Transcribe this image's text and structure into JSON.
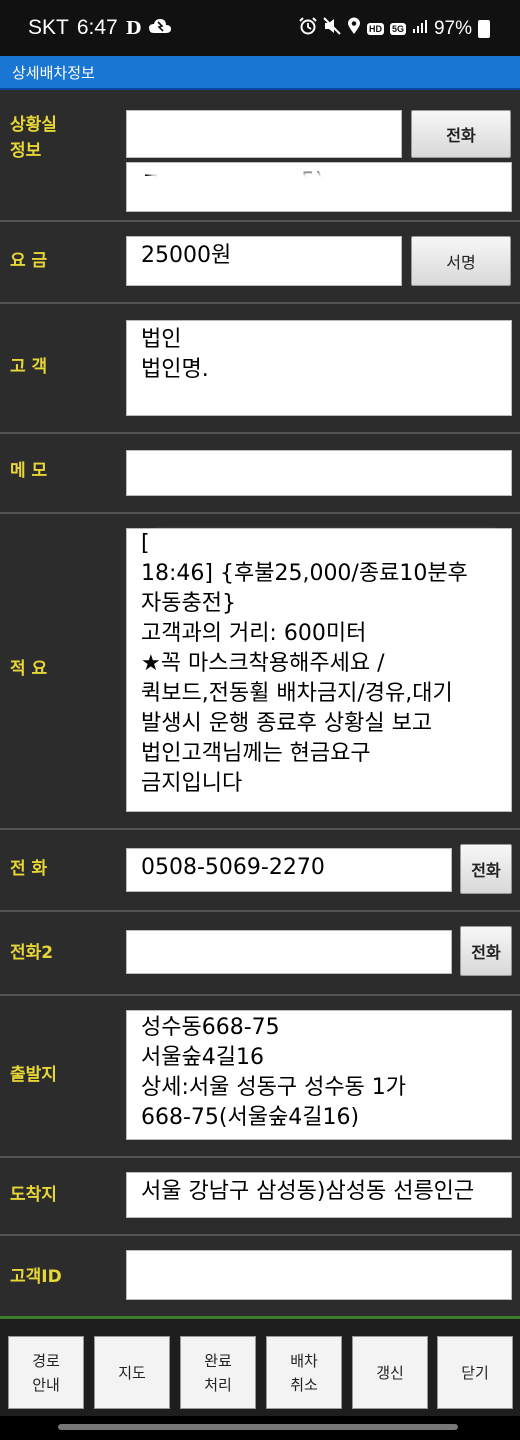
{
  "status_bar": {
    "carrier": "SKT",
    "time": "6:47",
    "extra": "D",
    "battery": "97%",
    "hd_badge": "HD",
    "fiveg_badge": "5G"
  },
  "title": "상세배차정보",
  "situation": {
    "label": "상황실\n정보",
    "value_top": "",
    "value_bottom": "ㄱ                    5)",
    "call_button": "전화"
  },
  "fare": {
    "label": "요 금",
    "value": "25000원",
    "sign_button": "서명"
  },
  "customer": {
    "label": "고 객",
    "value": "법인\n법인명."
  },
  "memo": {
    "label": "메 모",
    "value": ""
  },
  "summary": {
    "label": "적 요",
    "value": "[             \n18:46] {후불25,000/종료10분후\n자동충전}\n고객과의 거리: 600미터\n★꼭 마스크착용해주세요 /\n퀵보드,전동휠 배차금지/경유,대기\n발생시 운행 종료후 상황실 보고\n법인고객님께는 현금요구\n금지입니다"
  },
  "phone": {
    "label": "전 화",
    "value": "0508-5069-2270",
    "call_button": "전화"
  },
  "phone2": {
    "label": "전화2",
    "value": "",
    "call_button": "전화"
  },
  "departure": {
    "label": "출발지",
    "value": "성수동668-75\n서울숲4길16\n상세:서울 성동구 성수동 1가\n668-75(서울숲4길16)"
  },
  "destination": {
    "label": "도착지",
    "value": "서울 강남구 삼성동)삼성동 선릉인근"
  },
  "customer_id": {
    "label": "고객ID",
    "value": ""
  },
  "bottom_buttons": {
    "route": "경로\n안내",
    "map": "지도",
    "complete": "완료\n처리",
    "cancel": "배차\n취소",
    "refresh": "갱신",
    "close": "닫기"
  }
}
